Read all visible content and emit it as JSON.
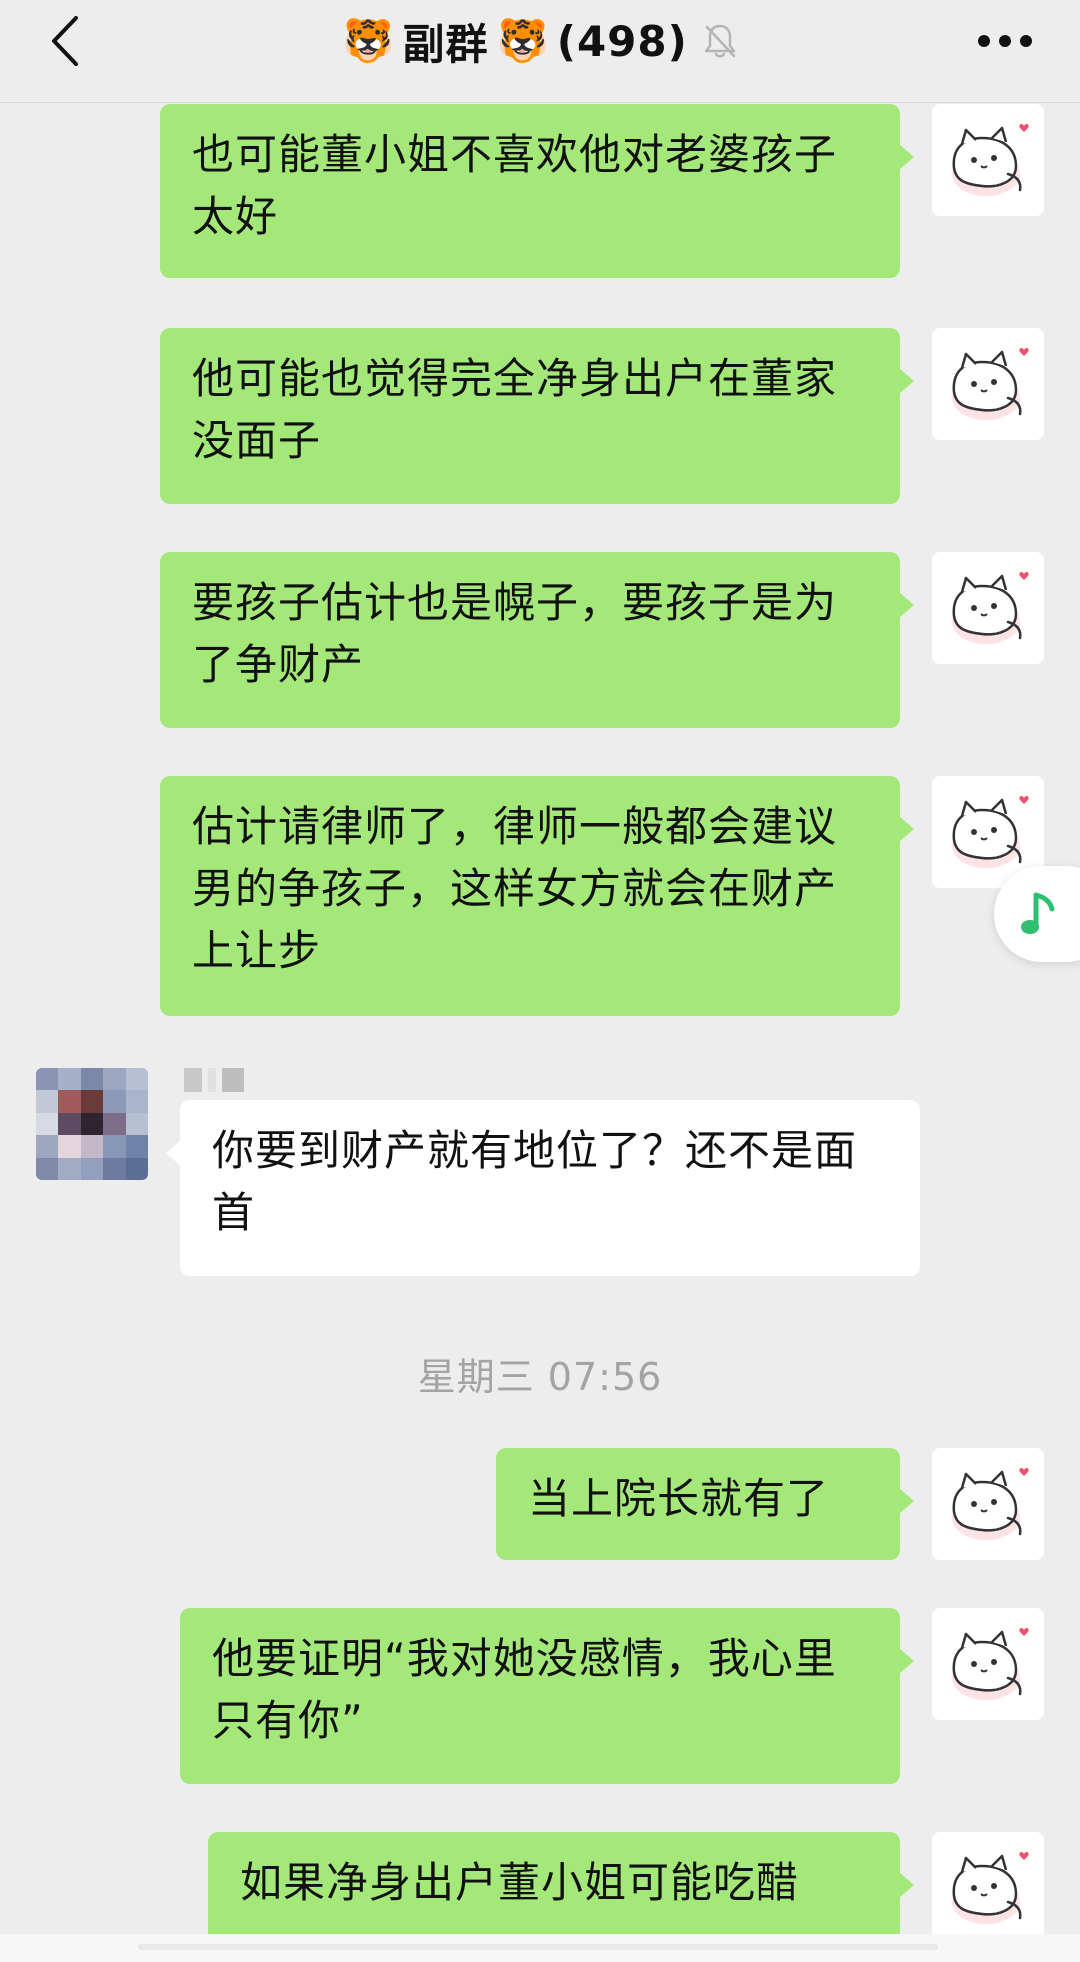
{
  "header": {
    "title_emoji": "🐯",
    "title_text": "副群",
    "member_count": "(498)",
    "icons": {
      "back": "chevron-left-icon",
      "mute": "bell-off-icon",
      "more": "more-dots-icon"
    }
  },
  "messages": [
    {
      "sender": "self",
      "text": "也可能董小姐不喜欢他对老婆孩子太好"
    },
    {
      "sender": "self",
      "text": "他可能也觉得完全净身出户在董家没面子"
    },
    {
      "sender": "self",
      "text": "要孩子估计也是幌子，要孩子是为了争财产"
    },
    {
      "sender": "self",
      "text": "估计请律师了，律师一般都会建议男的争孩子，这样女方就会在财产上让步"
    },
    {
      "sender": "other",
      "text": "你要到财产就有地位了？还不是面首"
    },
    {
      "type": "timestamp",
      "text": "星期三 07:56"
    },
    {
      "sender": "self",
      "text": "当上院长就有了"
    },
    {
      "sender": "self",
      "text": "他要证明“我对她没感情，我心里只有你”"
    },
    {
      "sender": "self",
      "text": "如果净身出户董小姐可能吃醋"
    }
  ],
  "colors": {
    "self_bubble": "#a5e87a",
    "other_bubble": "#ffffff",
    "background": "#ededed",
    "timestamp": "#a3a3a3",
    "music_note": "#2fbf71"
  },
  "floating": {
    "icon": "music-note-icon"
  },
  "avatars": {
    "self": "cat-sticker-avatar",
    "other": "pixelated-avatar"
  }
}
